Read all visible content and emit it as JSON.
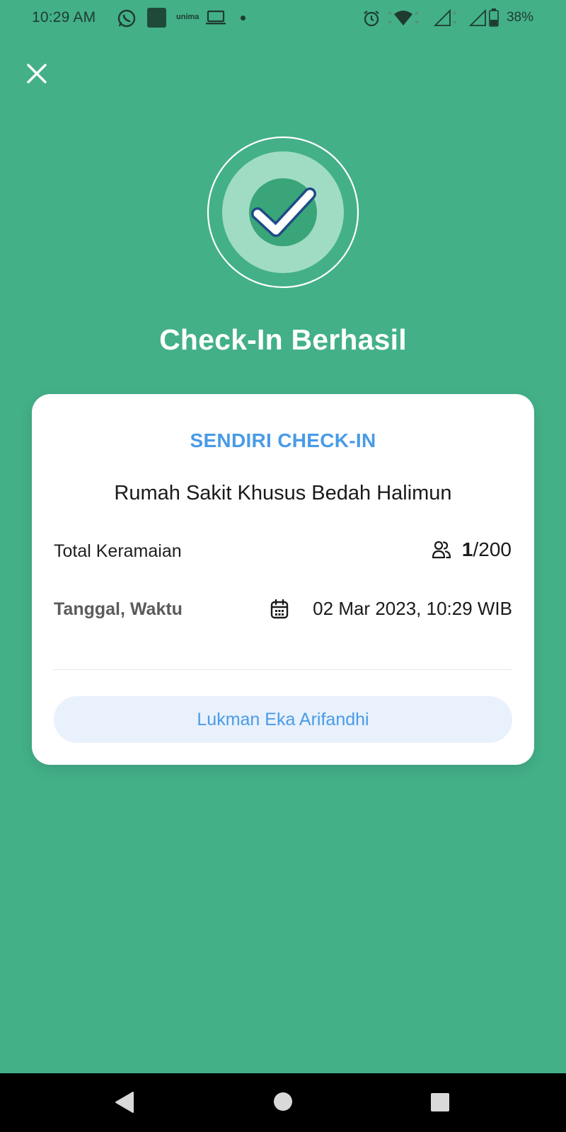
{
  "status_bar": {
    "time": "10:29 AM",
    "notification_icons": [
      "whatsapp-icon",
      "app-icon",
      "unima-icon",
      "laptop-icon",
      "dot-icon"
    ],
    "unima_label": "unima",
    "system_icons": [
      "alarm-icon",
      "wifi-icon",
      "signal-icon",
      "signal-icon",
      "battery-icon"
    ],
    "battery": "38%"
  },
  "header": {
    "close_icon": "close-icon"
  },
  "success": {
    "icon": "check-circle-icon",
    "title": "Check-In Berhasil"
  },
  "card": {
    "type_label": "SENDIRI CHECK-IN",
    "venue": "Rumah Sakit Khusus Bedah Halimun",
    "crowd": {
      "label": "Total Keramaian",
      "icon": "people-icon",
      "current": "1",
      "separator": "/",
      "capacity": "200"
    },
    "datetime": {
      "label": "Tanggal, Waktu",
      "icon": "calendar-icon",
      "value": "02 Mar 2023, 10:29 WIB"
    },
    "user_name": "Lukman Eka Arifandhi"
  },
  "nav": {
    "back_icon": "back-icon",
    "home_icon": "home-icon",
    "recents_icon": "recents-icon"
  },
  "colors": {
    "background": "#43b088",
    "accent_blue": "#4a9be6",
    "pill_background": "#e8f1fc"
  }
}
